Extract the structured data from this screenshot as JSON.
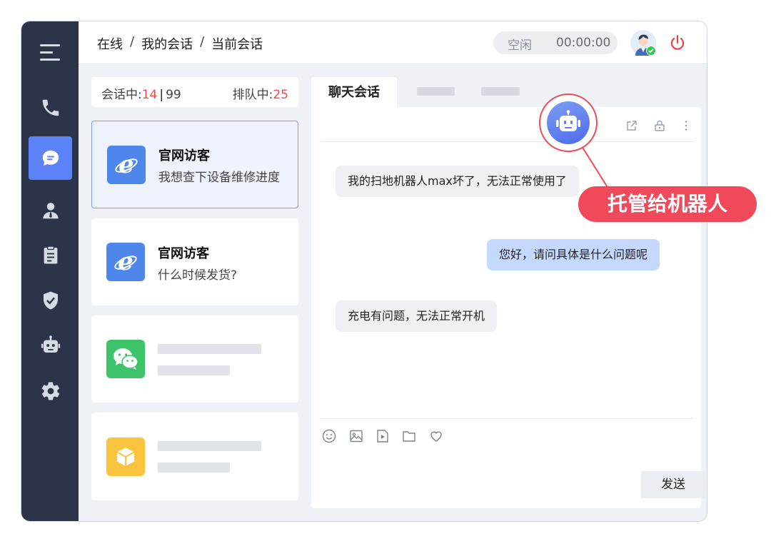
{
  "header": {
    "breadcrumb": [
      "在线",
      "我的会话",
      "当前会话"
    ],
    "separator": "/",
    "status": "空闲",
    "timer": "00:00:00"
  },
  "sidebar": {
    "items": [
      {
        "icon": "menu-icon"
      },
      {
        "icon": "phone-icon"
      },
      {
        "icon": "chat-icon",
        "active": true
      },
      {
        "icon": "user-icon"
      },
      {
        "icon": "clipboard-icon"
      },
      {
        "icon": "shield-check-icon"
      },
      {
        "icon": "robot-icon"
      },
      {
        "icon": "gear-icon"
      }
    ]
  },
  "counts": {
    "in_session_label": "会话中:",
    "in_session_current": "14",
    "divider": "|",
    "in_session_max": "99",
    "queue_label": "排队中:",
    "queue_count": "25"
  },
  "sessions": [
    {
      "channel_icon": "ie-icon",
      "title": "官网访客",
      "preview": "我想查下设备维修进度",
      "active": true
    },
    {
      "channel_icon": "ie-icon",
      "title": "官网访客",
      "preview": "什么时候发货?"
    },
    {
      "channel_icon": "wechat-icon"
    },
    {
      "channel_icon": "box-icon"
    }
  ],
  "chat": {
    "tab_label": "聊天会话",
    "messages": [
      {
        "from": "visitor",
        "text": "我的扫地机器人max坏了，无法正常使用了"
      },
      {
        "from": "agent",
        "text": "您好，请问具体是什么问题呢"
      },
      {
        "from": "visitor",
        "text": "充电有问题，无法正常开机"
      }
    ],
    "send_label": "发送"
  },
  "callout": {
    "label": "托管给机器人"
  },
  "colors": {
    "sidebar": "#2b3547",
    "accent": "#5b82f6",
    "alert": "#f0495a",
    "agent_bubble": "#c5d8ff"
  }
}
